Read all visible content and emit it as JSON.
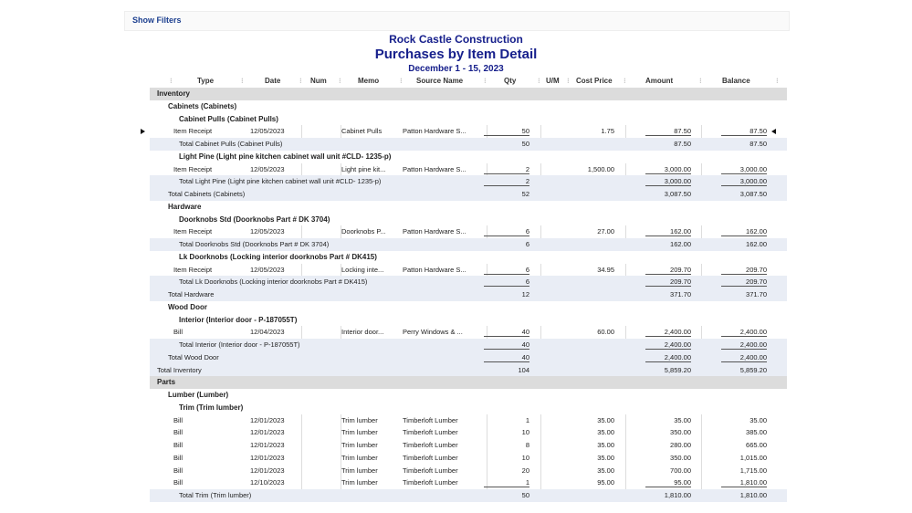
{
  "filters": {
    "show_label": "Show Filters"
  },
  "report": {
    "company": "Rock Castle Construction",
    "title": "Purchases by Item Detail",
    "date_range": "December 1 - 15, 2023"
  },
  "columns": [
    "Type",
    "Date",
    "Num",
    "Memo",
    "Source Name",
    "Qty",
    "U/M",
    "Cost Price",
    "Amount",
    "Balance"
  ],
  "rows": [
    {
      "kind": "section",
      "indent": 0,
      "label": "Inventory"
    },
    {
      "kind": "head",
      "indent": 1,
      "label": "Cabinets (Cabinets)"
    },
    {
      "kind": "head",
      "indent": 2,
      "label": "Cabinet Pulls (Cabinet Pulls)"
    },
    {
      "kind": "detail",
      "type": "Item Receipt",
      "date": "12/05/2023",
      "num": "",
      "memo": "Cabinet Pulls",
      "source": "Patton Hardware S...",
      "qty": "50",
      "um": "",
      "cost": "1.75",
      "amount": "87.50",
      "balance": "87.50",
      "ul_qty": true,
      "ul_amount": true,
      "ul_balance": true,
      "selected": true
    },
    {
      "kind": "total",
      "indent": 2,
      "label": "Total Cabinet Pulls (Cabinet Pulls)",
      "qty": "50",
      "amount": "87.50",
      "balance": "87.50"
    },
    {
      "kind": "head",
      "indent": 2,
      "label": "Light Pine (Light pine kitchen cabinet wall unit  #CLD- 1235-p)"
    },
    {
      "kind": "detail",
      "type": "Item Receipt",
      "date": "12/05/2023",
      "num": "",
      "memo": "Light pine kit...",
      "source": "Patton Hardware S...",
      "qty": "2",
      "um": "",
      "cost": "1,500.00",
      "amount": "3,000.00",
      "balance": "3,000.00",
      "ul_qty": true,
      "ul_amount": true,
      "ul_balance": true
    },
    {
      "kind": "total",
      "indent": 2,
      "label": "Total Light Pine (Light pine kitchen cabinet wall unit  #CLD- 1235-p)",
      "qty": "2",
      "amount": "3,000.00",
      "balance": "3,000.00",
      "ul_qty": true,
      "ul_amount": true,
      "ul_balance": true
    },
    {
      "kind": "total",
      "indent": 1,
      "label": "Total Cabinets (Cabinets)",
      "qty": "52",
      "amount": "3,087.50",
      "balance": "3,087.50"
    },
    {
      "kind": "head",
      "indent": 1,
      "label": "Hardware"
    },
    {
      "kind": "head",
      "indent": 2,
      "label": "Doorknobs Std (Doorknobs Part # DK 3704)"
    },
    {
      "kind": "detail",
      "type": "Item Receipt",
      "date": "12/05/2023",
      "num": "",
      "memo": "Doorknobs P...",
      "source": "Patton Hardware S...",
      "qty": "6",
      "um": "",
      "cost": "27.00",
      "amount": "162.00",
      "balance": "162.00",
      "ul_qty": true,
      "ul_amount": true,
      "ul_balance": true
    },
    {
      "kind": "total",
      "indent": 2,
      "label": "Total Doorknobs Std (Doorknobs Part # DK 3704)",
      "qty": "6",
      "amount": "162.00",
      "balance": "162.00"
    },
    {
      "kind": "head",
      "indent": 2,
      "label": "Lk Doorknobs (Locking interior doorknobs  Part # DK415)"
    },
    {
      "kind": "detail",
      "type": "Item Receipt",
      "date": "12/05/2023",
      "num": "",
      "memo": "Locking inte...",
      "source": "Patton Hardware S...",
      "qty": "6",
      "um": "",
      "cost": "34.95",
      "amount": "209.70",
      "balance": "209.70",
      "ul_qty": true,
      "ul_amount": true,
      "ul_balance": true
    },
    {
      "kind": "total",
      "indent": 2,
      "label": "Total Lk Doorknobs (Locking interior doorknobs  Part # DK415)",
      "qty": "6",
      "amount": "209.70",
      "balance": "209.70",
      "ul_qty": true,
      "ul_amount": true,
      "ul_balance": true
    },
    {
      "kind": "total",
      "indent": 1,
      "label": "Total Hardware",
      "qty": "12",
      "amount": "371.70",
      "balance": "371.70"
    },
    {
      "kind": "head",
      "indent": 1,
      "label": "Wood Door"
    },
    {
      "kind": "head",
      "indent": 2,
      "label": "Interior (Interior door - P-187055T)"
    },
    {
      "kind": "detail",
      "type": "Bill",
      "date": "12/04/2023",
      "num": "",
      "memo": "Interior door...",
      "source": "Perry Windows & ...",
      "qty": "40",
      "um": "",
      "cost": "60.00",
      "amount": "2,400.00",
      "balance": "2,400.00",
      "ul_qty": true,
      "ul_amount": true,
      "ul_balance": true
    },
    {
      "kind": "total",
      "indent": 2,
      "label": "Total Interior (Interior door - P-187055T)",
      "qty": "40",
      "amount": "2,400.00",
      "balance": "2,400.00",
      "ul_qty": true,
      "ul_amount": true,
      "ul_balance": true
    },
    {
      "kind": "total",
      "indent": 1,
      "label": "Total Wood Door",
      "qty": "40",
      "amount": "2,400.00",
      "balance": "2,400.00",
      "ul_qty": true,
      "ul_amount": true,
      "ul_balance": true
    },
    {
      "kind": "total",
      "indent": 0,
      "label": "Total Inventory",
      "qty": "104",
      "amount": "5,859.20",
      "balance": "5,859.20"
    },
    {
      "kind": "section",
      "indent": 0,
      "label": "Parts"
    },
    {
      "kind": "head",
      "indent": 1,
      "label": "Lumber (Lumber)"
    },
    {
      "kind": "head",
      "indent": 2,
      "label": "Trim (Trim lumber)"
    },
    {
      "kind": "detail",
      "type": "Bill",
      "date": "12/01/2023",
      "num": "",
      "memo": "Trim lumber",
      "source": "Timberloft Lumber",
      "qty": "1",
      "um": "",
      "cost": "35.00",
      "amount": "35.00",
      "balance": "35.00"
    },
    {
      "kind": "detail",
      "type": "Bill",
      "date": "12/01/2023",
      "num": "",
      "memo": "Trim lumber",
      "source": "Timberloft Lumber",
      "qty": "10",
      "um": "",
      "cost": "35.00",
      "amount": "350.00",
      "balance": "385.00"
    },
    {
      "kind": "detail",
      "type": "Bill",
      "date": "12/01/2023",
      "num": "",
      "memo": "Trim lumber",
      "source": "Timberloft Lumber",
      "qty": "8",
      "um": "",
      "cost": "35.00",
      "amount": "280.00",
      "balance": "665.00"
    },
    {
      "kind": "detail",
      "type": "Bill",
      "date": "12/01/2023",
      "num": "",
      "memo": "Trim lumber",
      "source": "Timberloft Lumber",
      "qty": "10",
      "um": "",
      "cost": "35.00",
      "amount": "350.00",
      "balance": "1,015.00"
    },
    {
      "kind": "detail",
      "type": "Bill",
      "date": "12/01/2023",
      "num": "",
      "memo": "Trim lumber",
      "source": "Timberloft Lumber",
      "qty": "20",
      "um": "",
      "cost": "35.00",
      "amount": "700.00",
      "balance": "1,715.00"
    },
    {
      "kind": "detail",
      "type": "Bill",
      "date": "12/10/2023",
      "num": "",
      "memo": "Trim lumber",
      "source": "Timberloft Lumber",
      "qty": "1",
      "um": "",
      "cost": "95.00",
      "amount": "95.00",
      "balance": "1,810.00",
      "ul_qty": true,
      "ul_amount": true,
      "ul_balance": true
    },
    {
      "kind": "total",
      "indent": 2,
      "label": "Total Trim (Trim lumber)",
      "qty": "50",
      "amount": "1,810.00",
      "balance": "1,810.00"
    }
  ]
}
